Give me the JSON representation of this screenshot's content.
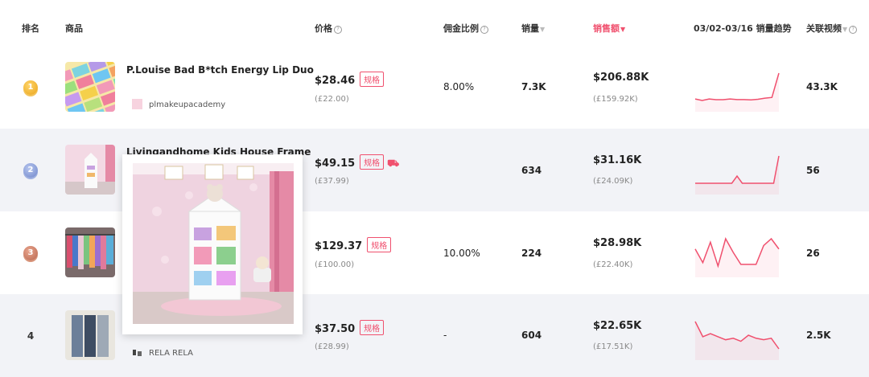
{
  "header": {
    "rank": "排名",
    "product": "商品",
    "price": "价格",
    "commission": "佣金比例",
    "sales": "销量",
    "revenue": "销售额",
    "trend": "03/02-03/16 销量趋势",
    "videos": "关联视频"
  },
  "rows": [
    {
      "rank": "1",
      "name": "P.Louise Bad B*tch Energy Lip Duo",
      "shop": "plmakeupacademy",
      "price": "$28.46",
      "price_local": "(£22.00)",
      "spec_tag": "规格",
      "commission": "8.00%",
      "sales": "7.3K",
      "revenue": "$206.88K",
      "revenue_local": "(£159.92K)",
      "videos": "43.3K"
    },
    {
      "rank": "2",
      "name": "Livingandhome Kids House Frame",
      "shop": "",
      "price": "$49.15",
      "price_local": "(£37.99)",
      "spec_tag": "规格",
      "commission": "",
      "sales": "634",
      "revenue": "$31.16K",
      "revenue_local": "(£24.09K)",
      "videos": "56"
    },
    {
      "rank": "3",
      "name": "",
      "shop": "",
      "price": "$129.37",
      "price_local": "(£100.00)",
      "spec_tag": "规格",
      "commission": "10.00%",
      "sales": "224",
      "revenue": "$28.98K",
      "revenue_local": "(£22.40K)",
      "videos": "26"
    },
    {
      "rank": "4",
      "name": "",
      "shop": "RELA RELA",
      "price": "$37.50",
      "price_local": "(£28.99)",
      "spec_tag": "规格",
      "commission": "-",
      "sales": "604",
      "revenue": "$22.65K",
      "revenue_local": "(£17.51K)",
      "videos": "2.5K"
    }
  ],
  "sparklines": [
    [
      3,
      2,
      3,
      2.5,
      2.5,
      3,
      2.6,
      2.6,
      2.4,
      2.8,
      3.5,
      4,
      20
    ],
    [
      1,
      1,
      1,
      1,
      1,
      1,
      1,
      1,
      6,
      1,
      1,
      1,
      1,
      1,
      1,
      1,
      20
    ],
    [
      14,
      6,
      18,
      4,
      20,
      12,
      5,
      5,
      5,
      16,
      20,
      14
    ],
    [
      18,
      8,
      10,
      8,
      6,
      7,
      5,
      9,
      7,
      6,
      7,
      0
    ]
  ],
  "colors": {
    "accent": "#f0506e",
    "alt_row": "#f2f3f7"
  }
}
